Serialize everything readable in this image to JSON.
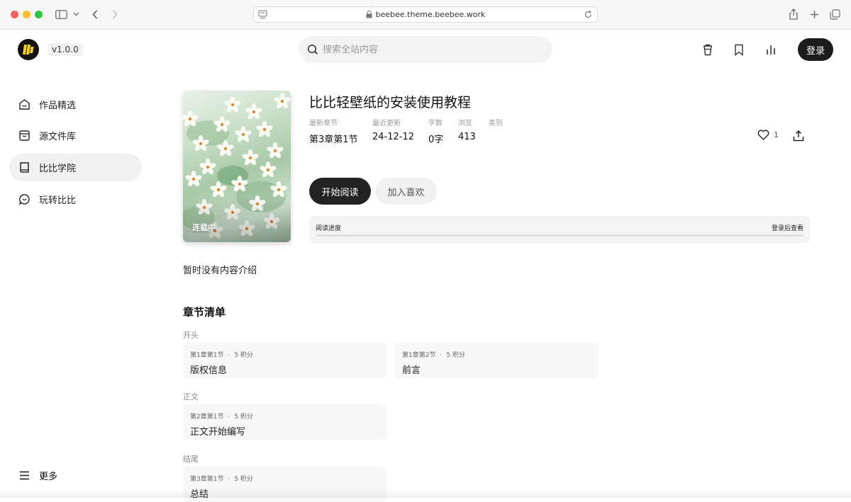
{
  "browser": {
    "url": "beebee.theme.beebee.work"
  },
  "header": {
    "version": "v1.0.0",
    "search_placeholder": "搜索全站内容",
    "login_label": "登录"
  },
  "sidebar": {
    "items": [
      {
        "label": "作品精选",
        "icon": "home-icon"
      },
      {
        "label": "源文件库",
        "icon": "shopping-bag-icon"
      },
      {
        "label": "比比学院",
        "icon": "book-icon"
      },
      {
        "label": "玩转比比",
        "icon": "chat-icon"
      }
    ],
    "more_label": "更多"
  },
  "book": {
    "title": "比比轻壁纸的安装使用教程",
    "cover_status": "连载中",
    "meta": [
      {
        "key": "最新章节",
        "value": "第3章第1节"
      },
      {
        "key": "最近更新",
        "value": "24-12-12"
      },
      {
        "key": "字数",
        "value": "0字"
      },
      {
        "key": "浏览",
        "value": "413"
      },
      {
        "key": "类别",
        "value": ""
      }
    ],
    "like_count": "1",
    "read_label": "开始阅读",
    "fav_label": "加入喜欢",
    "progress_label": "阅读进度",
    "progress_hint": "登录后查看",
    "progress_value": 0,
    "intro": "暂时没有内容介绍"
  },
  "chapters": {
    "title": "章节清单",
    "groups": [
      {
        "label": "开头",
        "items": [
          {
            "number": "第1章第1节",
            "points": "5 积分",
            "name": "版权信息"
          },
          {
            "number": "第1章第2节",
            "points": "5 积分",
            "name": "前言"
          }
        ]
      },
      {
        "label": "正文",
        "items": [
          {
            "number": "第2章第1节",
            "points": "5 积分",
            "name": "正文开始编写"
          }
        ]
      },
      {
        "label": "结尾",
        "items": [
          {
            "number": "第3章第1节",
            "points": "5 积分",
            "name": "总结"
          }
        ]
      }
    ]
  }
}
